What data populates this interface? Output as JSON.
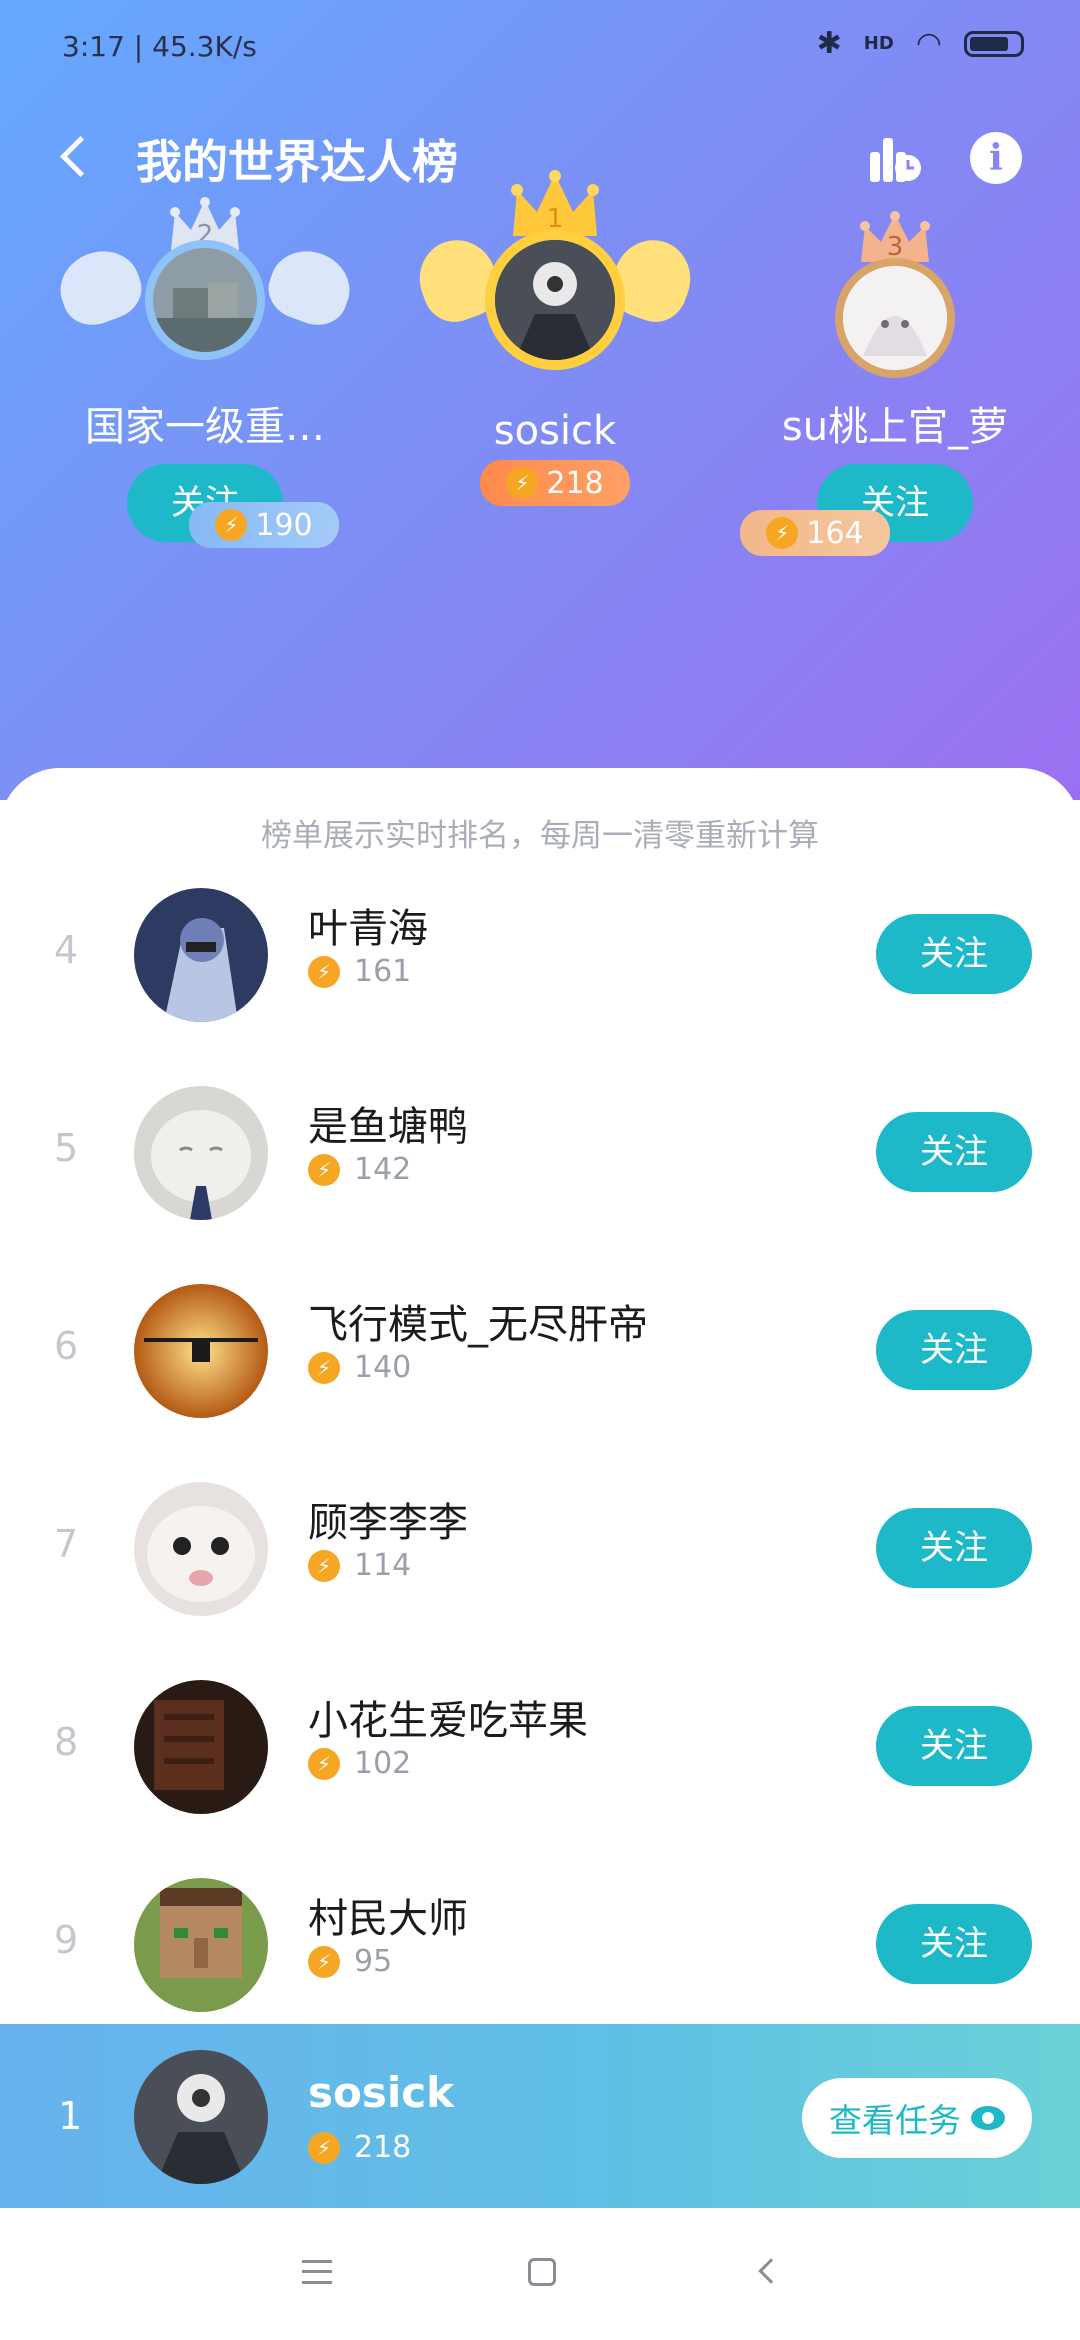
{
  "status": {
    "time": "3:17",
    "speed": "45.3K/s",
    "signal_label": "HD"
  },
  "header": {
    "title": "我的世界达人榜"
  },
  "notice": "榜单展示实时排名，每周一清零重新计算",
  "top3": [
    {
      "rank": "2",
      "name": "国家一级重…",
      "score": "190",
      "follow_label": "关注"
    },
    {
      "rank": "1",
      "name": "sosick",
      "score": "218"
    },
    {
      "rank": "3",
      "name": "su桃上官_萝",
      "score": "164",
      "follow_label": "关注"
    }
  ],
  "list": [
    {
      "rank": "4",
      "name": "叶青海",
      "score": "161",
      "follow_label": "关注"
    },
    {
      "rank": "5",
      "name": "是鱼塘鸭",
      "score": "142",
      "follow_label": "关注"
    },
    {
      "rank": "6",
      "name": "飞行模式_无尽肝帝",
      "score": "140",
      "follow_label": "关注"
    },
    {
      "rank": "7",
      "name": "顾李李李",
      "score": "114",
      "follow_label": "关注"
    },
    {
      "rank": "8",
      "name": "小花生爱吃苹果",
      "score": "102",
      "follow_label": "关注"
    },
    {
      "rank": "9",
      "name": "村民大师",
      "score": "95",
      "follow_label": "关注"
    }
  ],
  "me": {
    "rank": "1",
    "name": "sosick",
    "score": "218",
    "task_label": "查看任务"
  },
  "colors": {
    "accent": "#1eb9c9",
    "score_icon": "#f5a623"
  }
}
